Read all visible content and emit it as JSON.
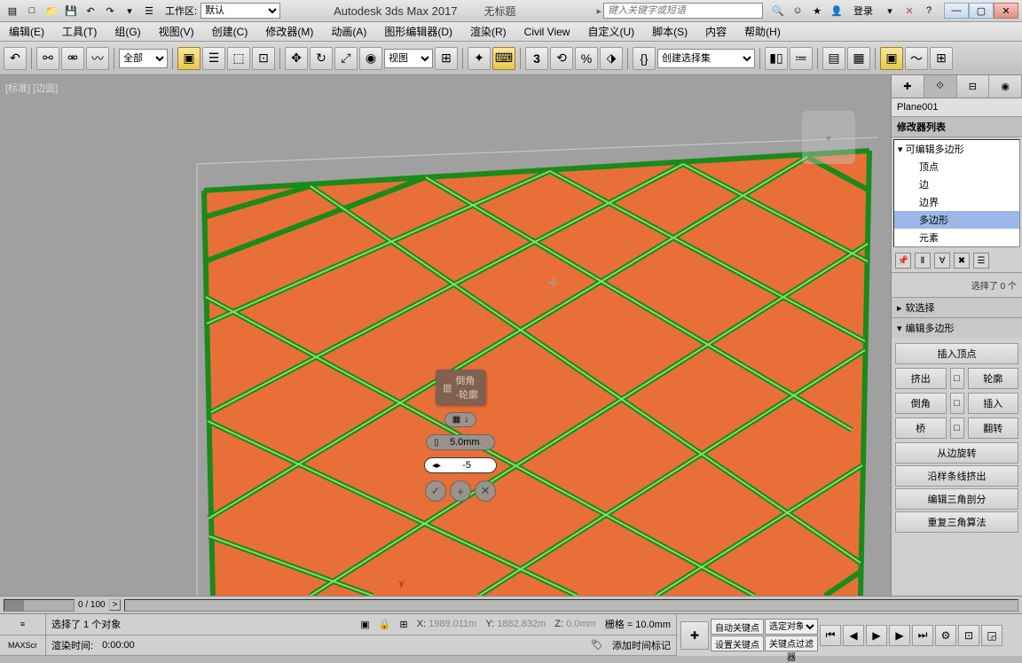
{
  "titlebar": {
    "workspace_label": "工作区:",
    "workspace_value": "默认",
    "app": "Autodesk 3ds Max 2017",
    "doc": "无标题",
    "search_placeholder": "键入关键字或短语",
    "login": "登录"
  },
  "menu": [
    "编辑(E)",
    "工具(T)",
    "组(G)",
    "视图(V)",
    "创建(C)",
    "修改器(M)",
    "动画(A)",
    "图形编辑器(D)",
    "渲染(R)",
    "Civil View",
    "自定义(U)",
    "脚本(S)",
    "内容",
    "帮助(H)"
  ],
  "toolbar": {
    "filter": "全部",
    "view_combo": "视图",
    "named_sel": "创建选择集"
  },
  "viewport": {
    "label": "[标准] [边面]",
    "caddy": {
      "title1": "倒角",
      "title2": "-轮廓",
      "height": "5.0mm",
      "outline": "-5"
    },
    "axis_y": "y"
  },
  "right": {
    "objname": "Plane001",
    "modlist_hdr": "修改器列表",
    "stack_root": "可编辑多边形",
    "stack": [
      "顶点",
      "边",
      "边界",
      "多边形",
      "元素"
    ],
    "stack_sel": 3,
    "sel_info": "选择了 0 个",
    "rollouts": {
      "soft": "软选择",
      "edit_poly": "编辑多边形",
      "insert_vertex": "插入顶点",
      "extrude": "挤出",
      "outline": "轮廓",
      "bevel": "倒角",
      "insert": "插入",
      "bridge": "桥",
      "flip": "翻转",
      "spin_edge": "从边旋转",
      "extrude_spline": "沿样条线挤出",
      "edit_tri": "编辑三角剖分",
      "retri": "重复三角算法"
    }
  },
  "timeline": {
    "frame": "0 / 100"
  },
  "status": {
    "sel": "选择了 1 个对象",
    "render_time_label": "渲染时间:",
    "render_time": "0:00:00",
    "maxscript": "MAXScr",
    "x_label": "X:",
    "x": "1989.011m",
    "y_label": "Y:",
    "y": "1882.832m",
    "z_label": "Z:",
    "z": "0.0mm",
    "grid_label": "栅格 =",
    "grid": "10.0mm",
    "add_marker": "添加时间标记",
    "autokey": "自动关键点",
    "selkey": "选定对象",
    "setkey": "设置关键点",
    "keyfilter": "关键点过滤器"
  }
}
